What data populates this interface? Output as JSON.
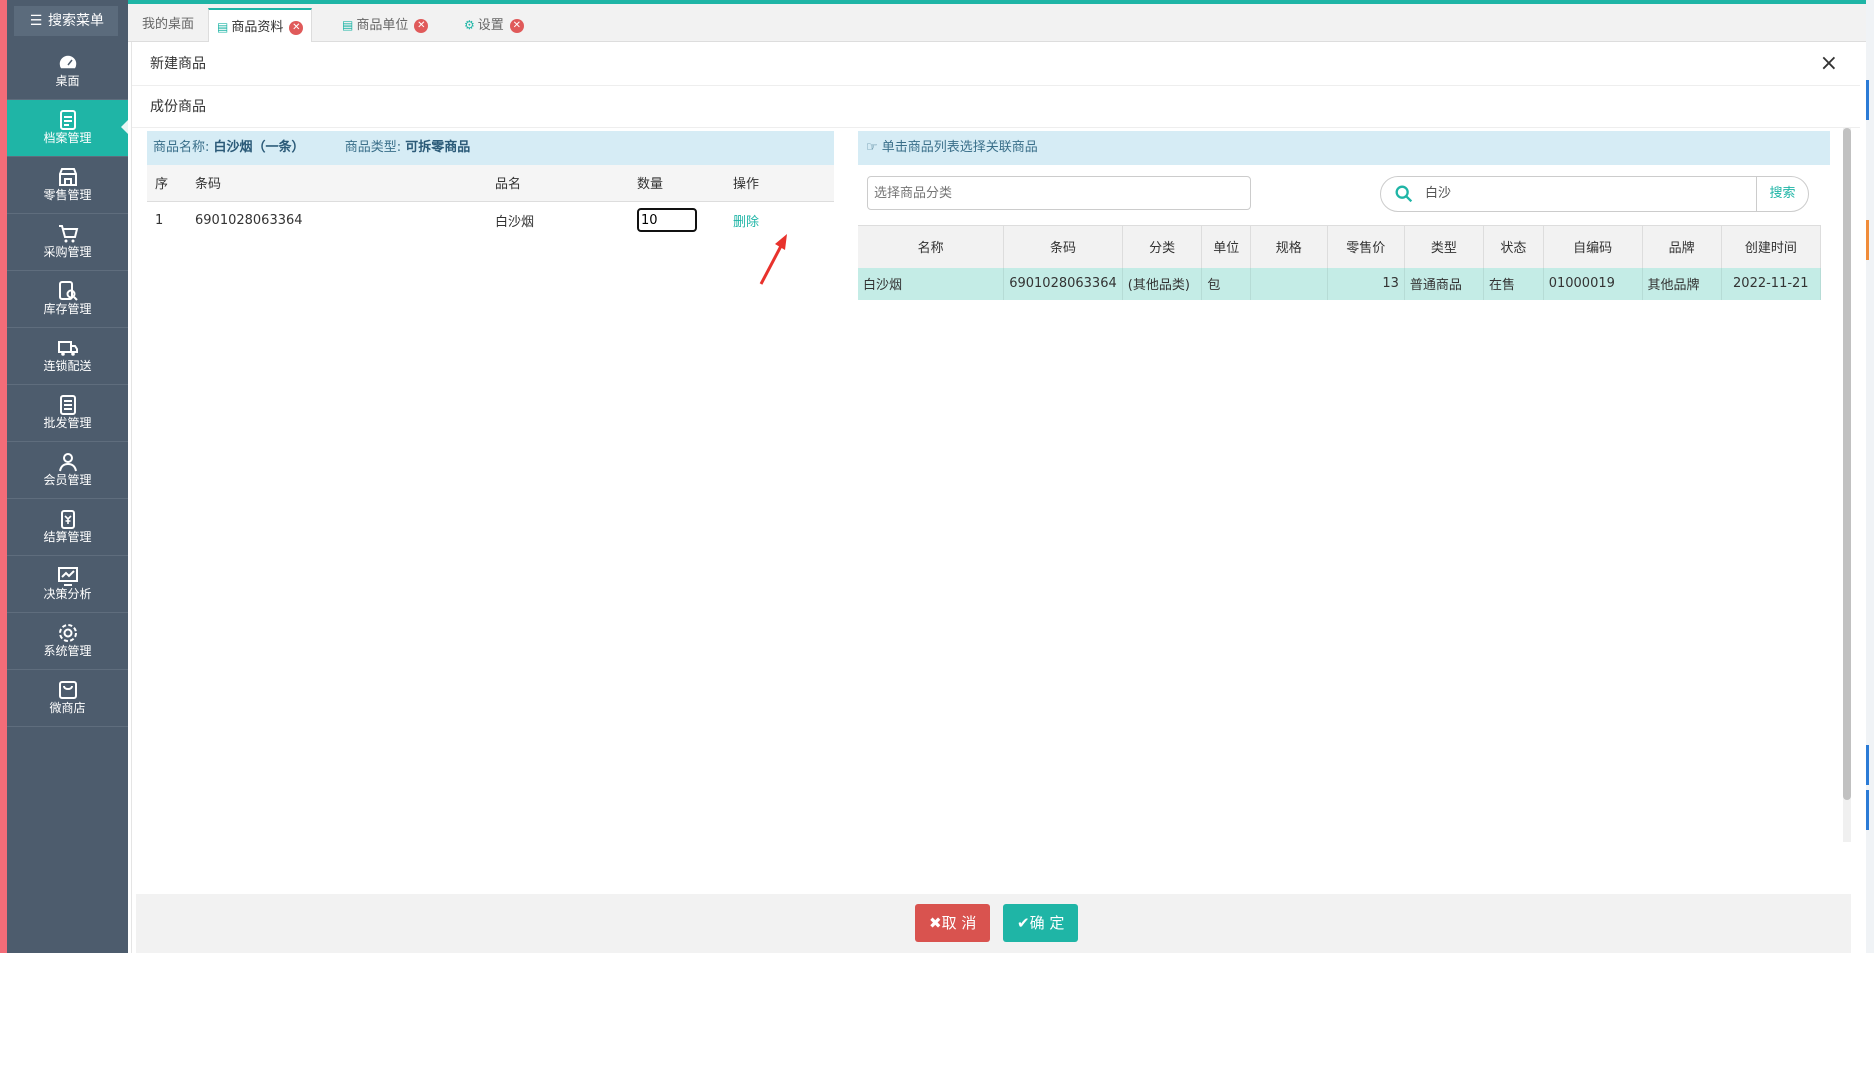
{
  "sidebar": {
    "search_label": "搜索菜单",
    "items": [
      {
        "label": "桌面",
        "icon": "dashboard-icon"
      },
      {
        "label": "档案管理",
        "icon": "archive-icon"
      },
      {
        "label": "零售管理",
        "icon": "store-icon"
      },
      {
        "label": "采购管理",
        "icon": "cart-icon"
      },
      {
        "label": "库存管理",
        "icon": "inventory-icon"
      },
      {
        "label": "连锁配送",
        "icon": "truck-icon"
      },
      {
        "label": "批发管理",
        "icon": "wholesale-icon"
      },
      {
        "label": "会员管理",
        "icon": "member-icon"
      },
      {
        "label": "结算管理",
        "icon": "settlement-icon"
      },
      {
        "label": "决策分析",
        "icon": "analysis-icon"
      },
      {
        "label": "系统管理",
        "icon": "gear-icon"
      },
      {
        "label": "微商店",
        "icon": "bag-icon"
      }
    ]
  },
  "tabs": [
    {
      "label": "我的桌面"
    },
    {
      "label": "商品资料"
    },
    {
      "label": "商品单位"
    },
    {
      "label": "设置"
    }
  ],
  "dialog": {
    "title": "新建商品",
    "subtitle": "成份商品",
    "close": "×",
    "left": {
      "name_label": "商品名称:",
      "name_value": "白沙烟（一条）",
      "type_label": "商品类型:",
      "type_value": "可拆零商品",
      "headers": [
        "序",
        "条码",
        "品名",
        "数量",
        "操作"
      ],
      "row": {
        "index": "1",
        "barcode": "6901028063364",
        "name": "白沙烟",
        "qty": "10",
        "action": "删除"
      }
    },
    "right": {
      "hint": "单击商品列表选择关联商品",
      "category_placeholder": "选择商品分类",
      "search_value": "白沙",
      "search_button": "搜索",
      "headers": [
        "名称",
        "条码",
        "分类",
        "单位",
        "规格",
        "零售价",
        "类型",
        "状态",
        "自编码",
        "品牌",
        "创建时间"
      ],
      "row": {
        "name": "白沙烟",
        "barcode": "6901028063364",
        "category": "(其他品类)",
        "unit": "包",
        "spec": "",
        "price": "13",
        "type": "普通商品",
        "status": "在售",
        "code": "01000019",
        "brand": "其他品牌",
        "created": "2022-11-21"
      }
    },
    "cancel_label": "取 消",
    "ok_label": "确 定"
  },
  "colors": {
    "accent": "#1fb5a6",
    "sidebar": "#4d5c6d",
    "danger": "#d9534f"
  }
}
